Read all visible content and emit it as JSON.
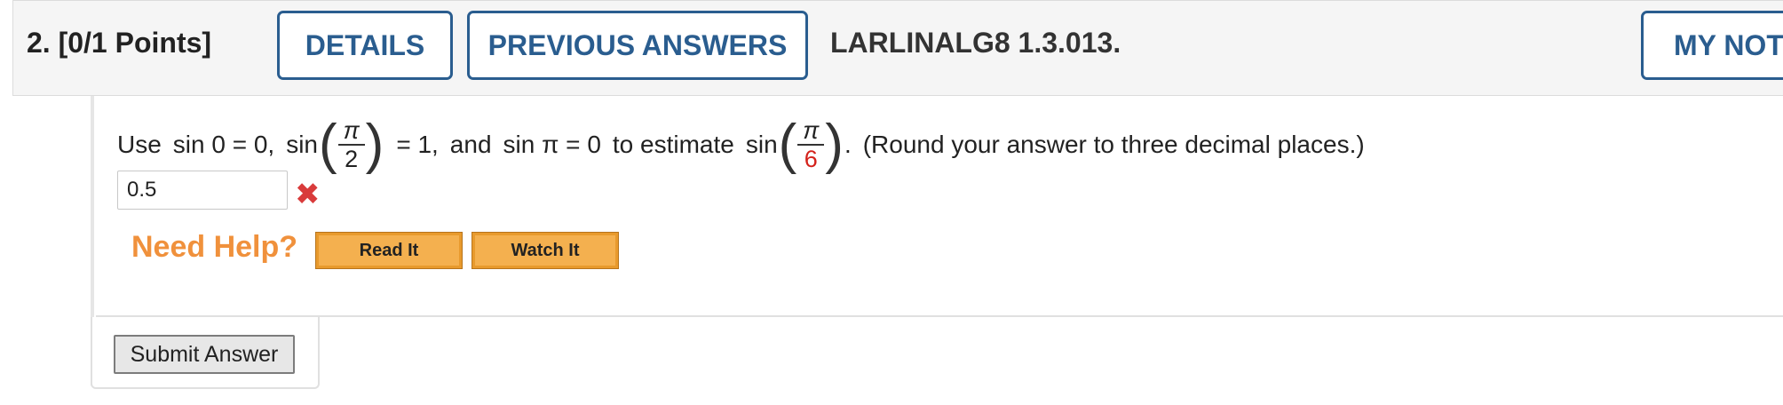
{
  "header": {
    "question_number": "2.",
    "points": "[0/1 Points]",
    "details_label": "DETAILS",
    "previous_answers_label": "PREVIOUS ANSWERS",
    "assignment_id": "LARLINALG8 1.3.013.",
    "my_notes_label": "MY NOTES"
  },
  "question": {
    "use": "Use",
    "eq1": "sin 0 = 0,",
    "sin_a": "sin",
    "pi_a": "π",
    "den_a": "2",
    "eq2_rest": "= 1,",
    "and": "and",
    "eq3": "sin π = 0",
    "to_estimate": "to estimate",
    "sin_b": "sin",
    "pi_b": "π",
    "den_b": "6",
    "period": ".",
    "instruction": "(Round your answer to three decimal places.)"
  },
  "answer": {
    "value": "0.5",
    "status": "incorrect",
    "status_icon": "x-mark-icon"
  },
  "help": {
    "label": "Need Help?",
    "read_it": "Read It",
    "watch_it": "Watch It"
  },
  "submit_label": "Submit Answer",
  "colors": {
    "header_button": "#2a5d8f",
    "incorrect": "#d93b3b",
    "highlight_denominator": "#d4221b",
    "help_label": "#f0913c",
    "help_button": "#f4b04f"
  }
}
